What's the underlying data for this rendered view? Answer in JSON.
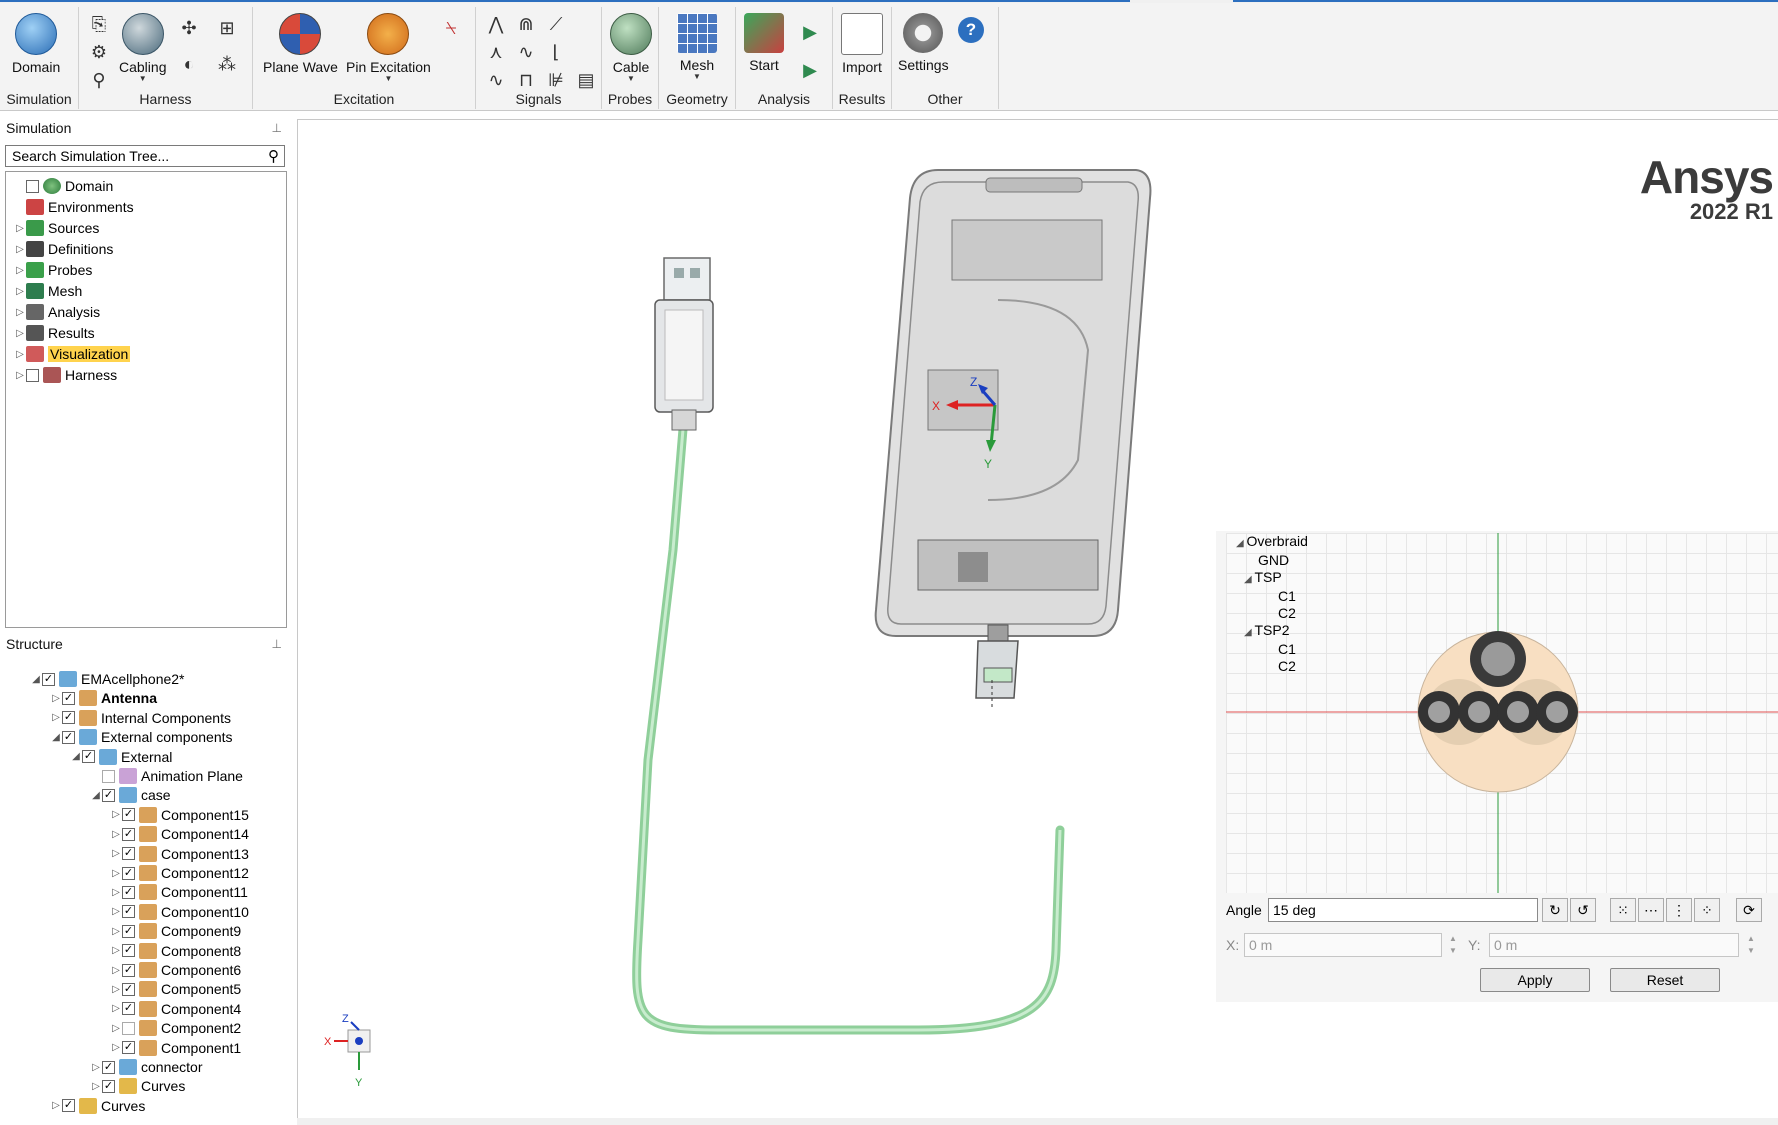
{
  "ribbon": {
    "groups": [
      {
        "label": "Simulation",
        "items": [
          "Domain"
        ]
      },
      {
        "label": "Harness",
        "items": [
          "Cabling"
        ]
      },
      {
        "label": "Excitation",
        "items": [
          "Plane Wave",
          "Pin Excitation"
        ]
      },
      {
        "label": "Signals",
        "items": []
      },
      {
        "label": "Probes",
        "items": [
          "Cable"
        ]
      },
      {
        "label": "Geometry",
        "items": [
          "Mesh"
        ]
      },
      {
        "label": "Analysis",
        "items": [
          "Start"
        ]
      },
      {
        "label": "Results",
        "items": [
          "Import"
        ]
      },
      {
        "label": "Other",
        "items": [
          "Settings"
        ]
      }
    ]
  },
  "simulation_panel": {
    "title": "Simulation",
    "search_placeholder": "Search Simulation Tree...",
    "tree": [
      "Domain",
      "Environments",
      "Sources",
      "Definitions",
      "Probes",
      "Mesh",
      "Analysis",
      "Results",
      "Visualization",
      "Harness"
    ],
    "selected": "Visualization"
  },
  "structure_panel": {
    "title": "Structure",
    "tree": [
      "EMAcellphone2*",
      "Antenna",
      "Internal Components",
      "External components",
      "External",
      "Animation Plane",
      "case",
      "Component15",
      "Component14",
      "Component13",
      "Component12",
      "Component11",
      "Component10",
      "Component9",
      "Component8",
      "Component6",
      "Component5",
      "Component4",
      "Component2",
      "Component1",
      "connector",
      "Curves",
      "Curves"
    ]
  },
  "viewport": {
    "brand_name": "Ansys",
    "brand_version": "2022 R1",
    "triad": {
      "x": "X",
      "y": "Y",
      "z": "Z"
    },
    "corner_triad": {
      "x": "X",
      "y": "Y",
      "z": "Z"
    }
  },
  "cross_section": {
    "tree": [
      "Overbraid",
      "GND",
      "TSP",
      "C1",
      "C2",
      "TSP2",
      "C1",
      "C2"
    ],
    "angle_label": "Angle",
    "angle_value": "15 deg",
    "x_label": "X:",
    "x_value": "0 m",
    "y_label": "Y:",
    "y_value": "0 m",
    "apply_label": "Apply",
    "reset_label": "Reset"
  },
  "colors": {
    "accent": "#2c6fbf",
    "cable": "#9fd6a4",
    "selection": "#ffd34d",
    "cross_section_fill": "#f8dfc2"
  }
}
